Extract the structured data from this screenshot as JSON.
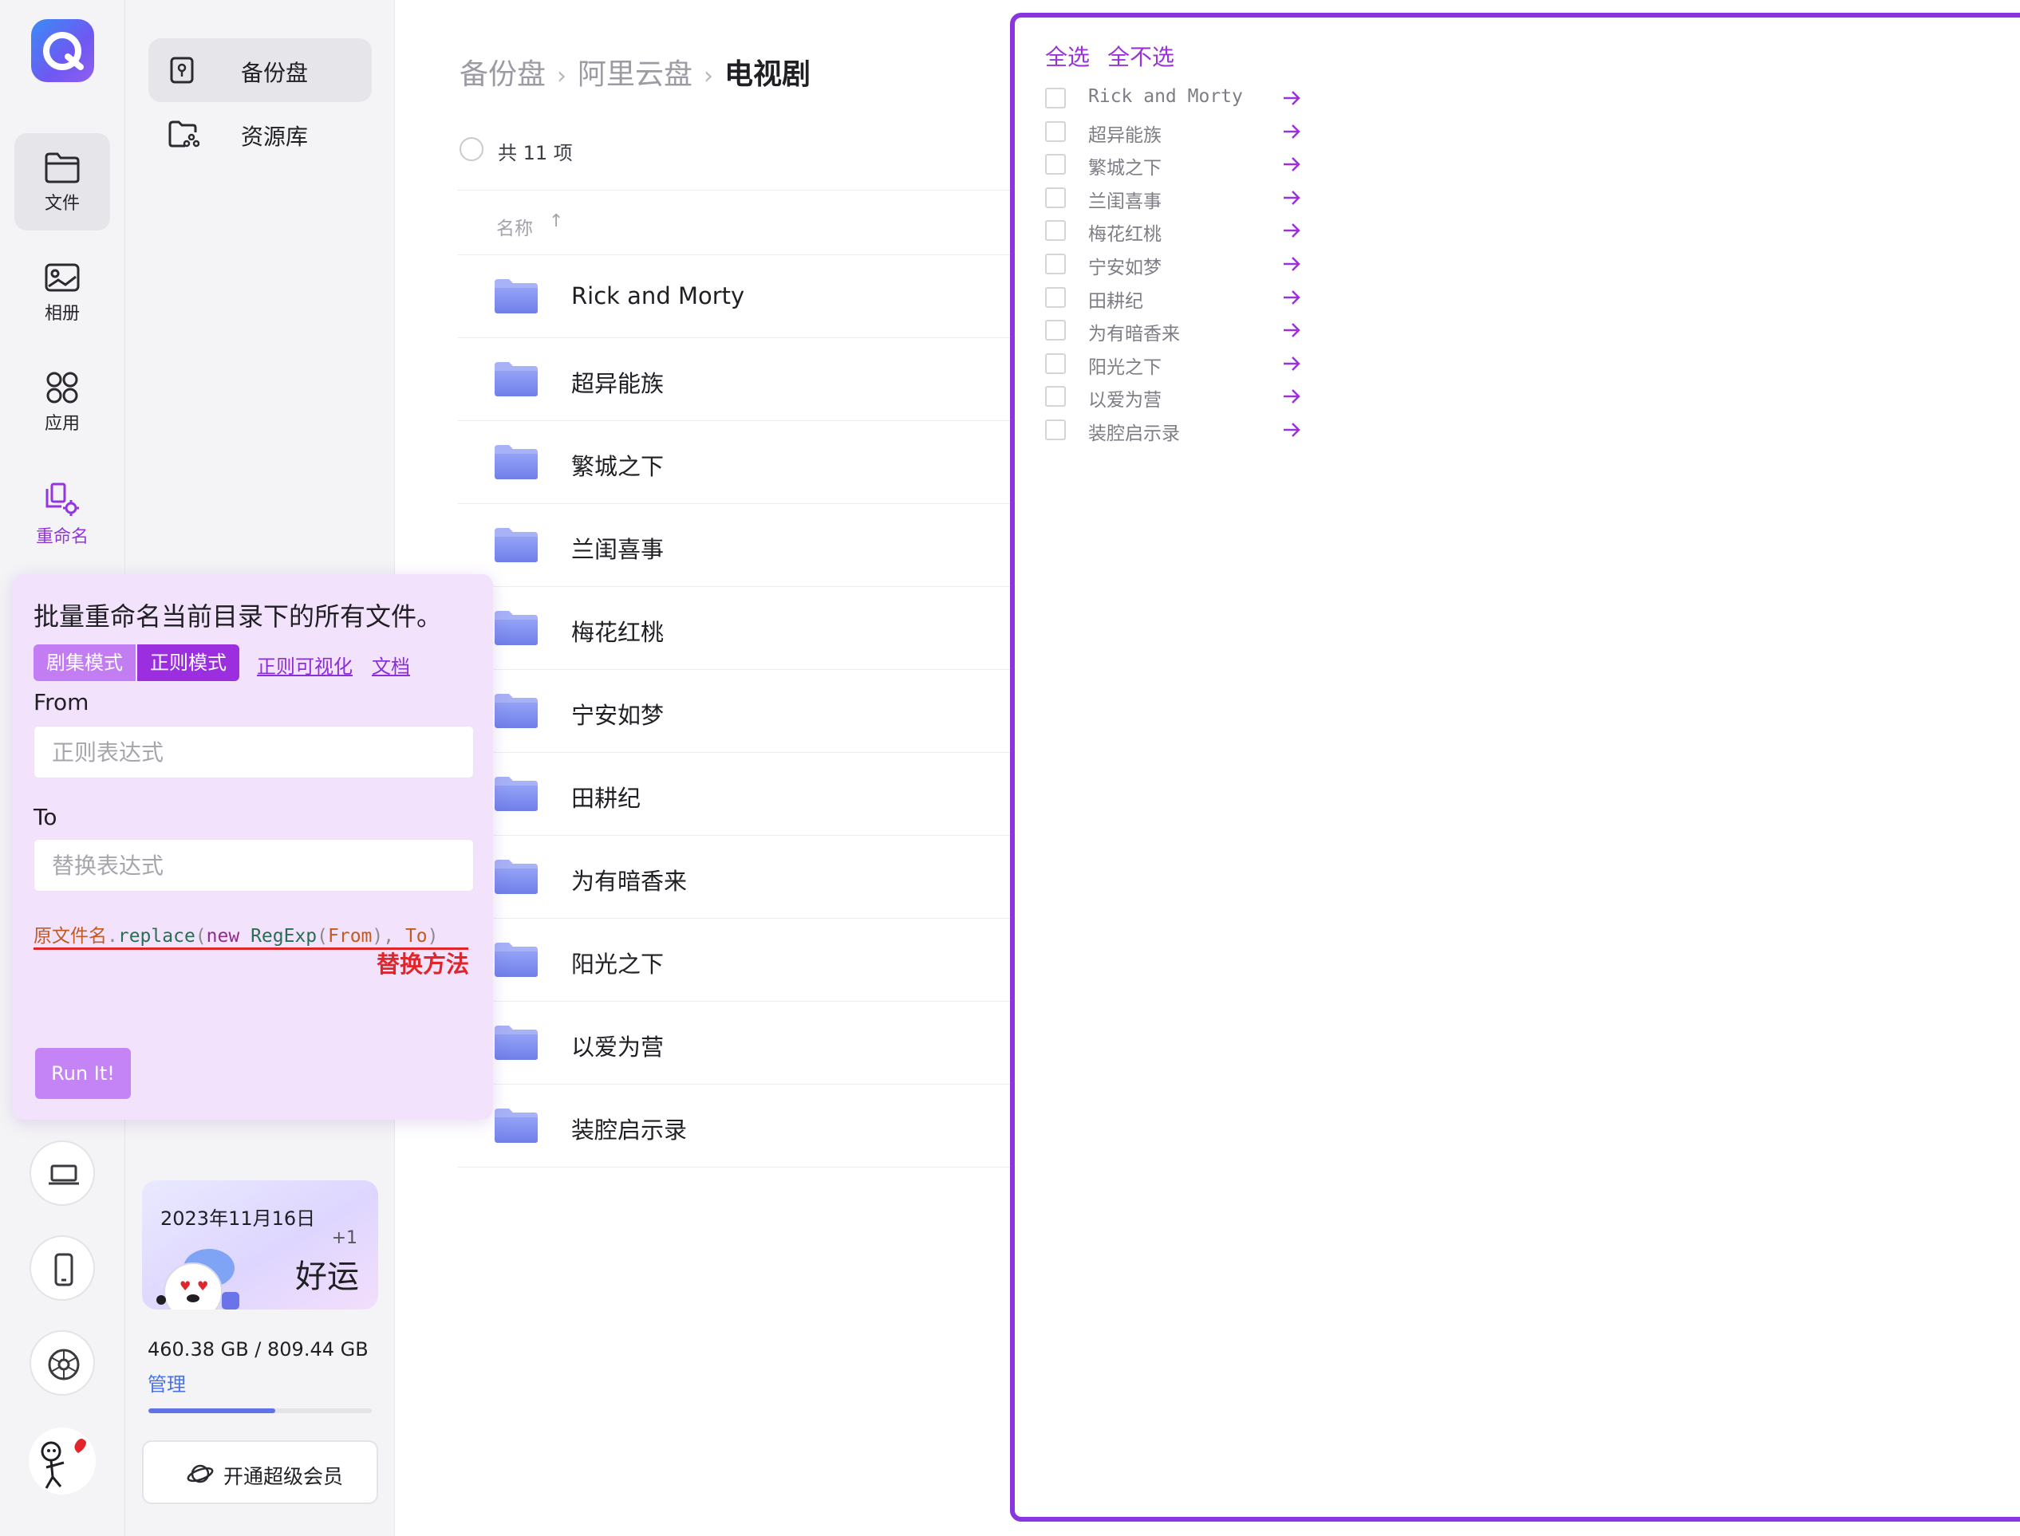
{
  "rail": {
    "items": [
      {
        "label": "文件",
        "icon": "folder-icon",
        "active": true
      },
      {
        "label": "相册",
        "icon": "photo-album-icon",
        "active": false
      },
      {
        "label": "应用",
        "icon": "apps-grid-icon",
        "active": false
      },
      {
        "label": "重命名",
        "icon": "rename-icon",
        "active": false
      }
    ],
    "bottom_icons": [
      "laptop-icon",
      "phone-icon",
      "settings-icon"
    ],
    "avatar": "avatar"
  },
  "sidebar": {
    "drives": [
      {
        "label": "备份盘",
        "icon": "backup-drive-icon",
        "active": true
      },
      {
        "label": "资源库",
        "icon": "resource-library-icon",
        "active": false
      }
    ],
    "checkin": {
      "date": "2023年11月16日",
      "plus": "+1",
      "luck": "好运"
    },
    "storage": {
      "text": "460.38 GB / 809.44 GB",
      "used_gb": 460.38,
      "total_gb": 809.44,
      "manage": "管理"
    },
    "vip_label": "开通超级会员"
  },
  "breadcrumb": [
    "备份盘",
    "阿里云盘",
    "电视剧"
  ],
  "file_list": {
    "count_text": "共 11 项",
    "column_name": "名称",
    "sort_arrow": "↑",
    "files": [
      "Rick and Morty",
      "超异能族",
      "繁城之下",
      "兰闺喜事",
      "梅花红桃",
      "宁安如梦",
      "田耕纪",
      "为有暗香来",
      "阳光之下",
      "以爱为营",
      "装腔启示录"
    ]
  },
  "rename_panel": {
    "title": "批量重命名当前目录下的所有文件。",
    "tabs": [
      "剧集模式",
      "正则模式"
    ],
    "active_tab": "正则模式",
    "links": [
      "正则可视化",
      "文档"
    ],
    "from_label": "From",
    "from_placeholder": "正则表达式",
    "from_value": "",
    "to_label": "To",
    "to_placeholder": "替换表达式",
    "to_value": "",
    "code": {
      "orig": "原文件名",
      "dot": ".",
      "method": "replace",
      "open": "(",
      "kw": "new",
      "cls": "RegExp",
      "open2": "(",
      "from": "From",
      "close_comma": "), ",
      "to": "To",
      "close": ")"
    },
    "replace_note": "替换方法",
    "run_button": "Run It!"
  },
  "preview": {
    "select_all": "全选",
    "select_none": "全不选",
    "items": [
      "Rick and Morty",
      "超异能族",
      "繁城之下",
      "兰闺喜事",
      "梅花红桃",
      "宁安如梦",
      "田耕纪",
      "为有暗香来",
      "阳光之下",
      "以爱为营",
      "装腔启示录"
    ]
  },
  "colors": {
    "accent": "#9435e0",
    "panel_border": "#8a35e2",
    "folder": "#7f8ff0",
    "link_blue": "#4a70e6",
    "danger": "#e0262b"
  }
}
